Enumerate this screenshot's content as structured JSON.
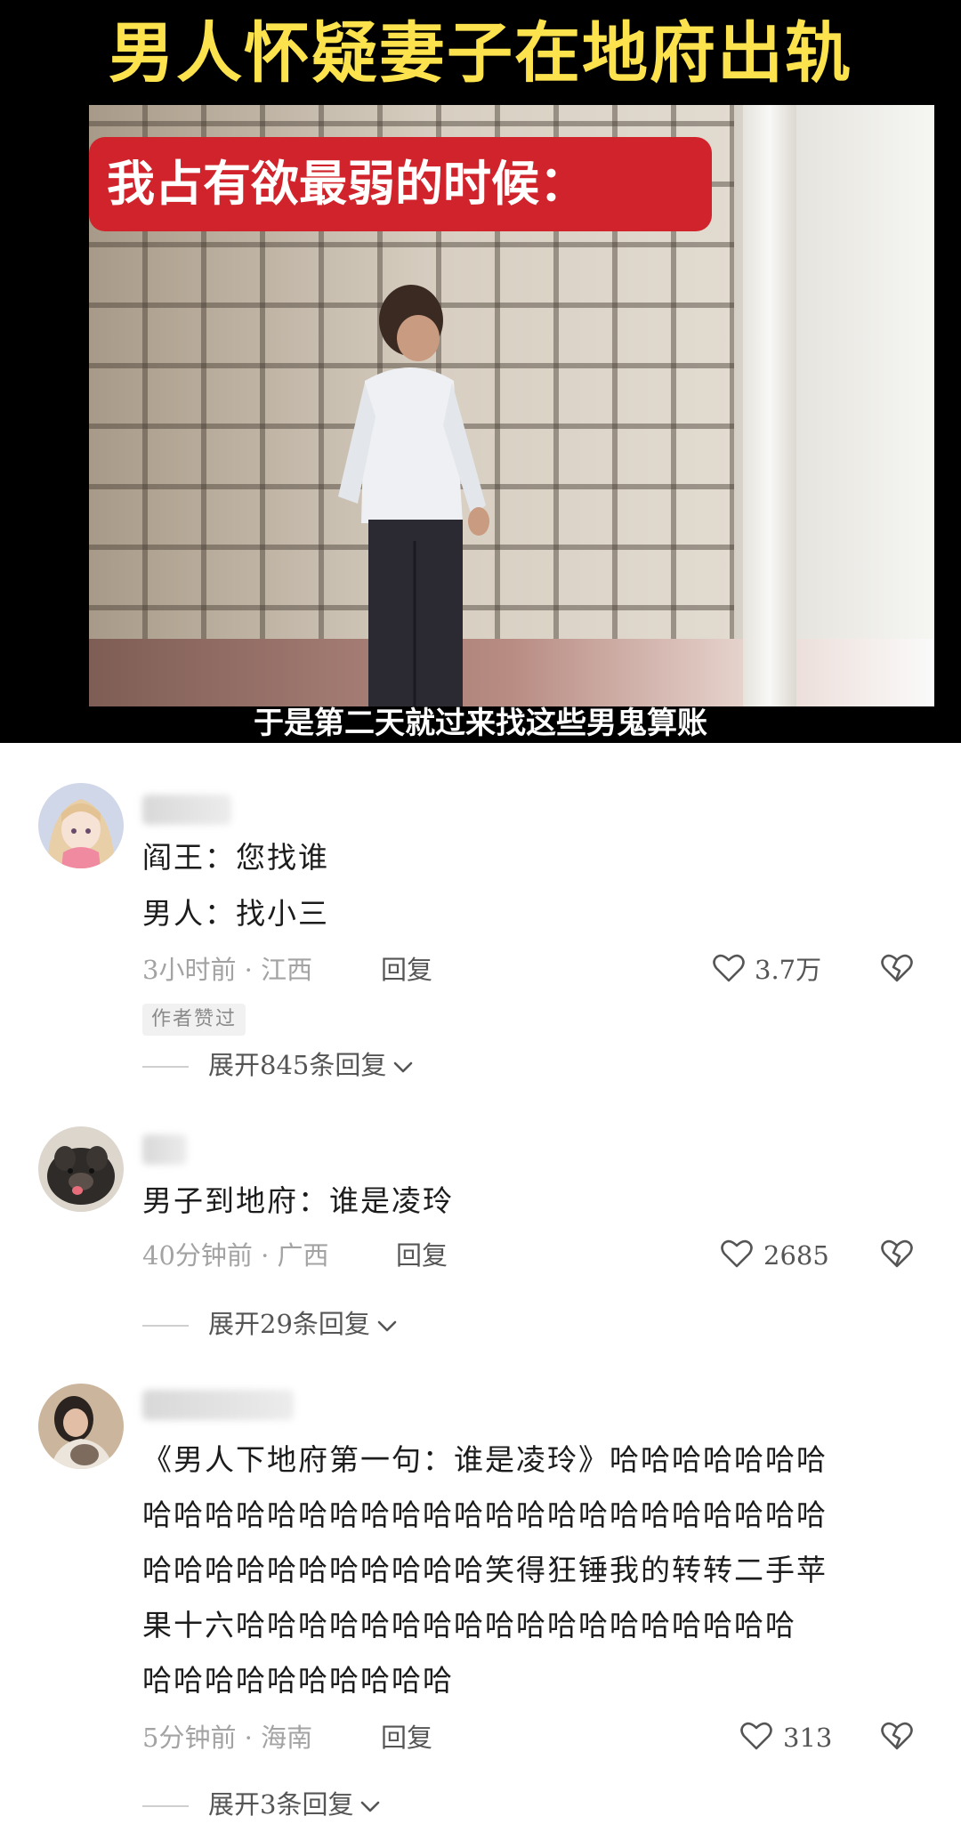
{
  "video": {
    "title": "男人怀疑妻子在地府出轨",
    "banner": "我占有欲最弱的时候：",
    "subtitle": "于是第二天就过来找这些男鬼算账"
  },
  "comments": [
    {
      "lines": [
        "阎王：您找谁",
        "男人：找小三"
      ],
      "time_location": "3小时前 · 江西",
      "reply_label": "回复",
      "like_count": "3.7万",
      "badge": "作者赞过",
      "expand_label": "展开845条回复"
    },
    {
      "lines": [
        "男子到地府：谁是凌玲"
      ],
      "time_location": "40分钟前 · 广西",
      "reply_label": "回复",
      "like_count": "2685",
      "expand_label": "展开29条回复"
    },
    {
      "lines": [
        "《男人下地府第一句：谁是凌玲》哈哈哈哈哈哈哈",
        "哈哈哈哈哈哈哈哈哈哈哈哈哈哈哈哈哈哈哈哈哈哈",
        "哈哈哈哈哈哈哈哈哈哈哈笑得狂锤我的转转二手苹",
        "果十六哈哈哈哈哈哈哈哈哈哈哈哈哈哈哈哈哈哈",
        "哈哈哈哈哈哈哈哈哈哈"
      ],
      "time_location": "5分钟前 · 海南",
      "reply_label": "回复",
      "like_count": "313",
      "expand_label": "展开3条回复"
    }
  ],
  "icons": {
    "like": "heart-outline-icon",
    "dislike": "broken-heart-icon",
    "expand": "chevron-down-icon"
  }
}
